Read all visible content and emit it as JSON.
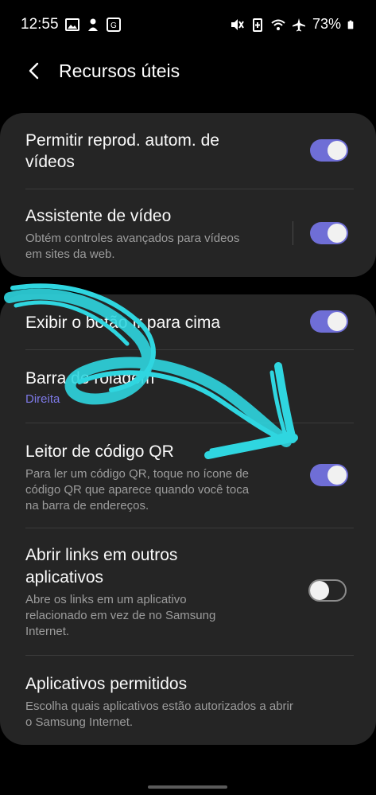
{
  "status_bar": {
    "time": "12:55",
    "battery": "73%",
    "left_icons": [
      "image-icon",
      "person-icon",
      "translate-icon"
    ],
    "right_icons": [
      "mute-icon",
      "battery-saver-icon",
      "wifi-icon",
      "airplane-icon",
      "battery-icon"
    ]
  },
  "header": {
    "title": "Recursos úteis"
  },
  "card1": {
    "items": [
      {
        "title_line1": "Permitir reprod. autom. de",
        "title_line2": "vídeos",
        "toggle": true
      },
      {
        "title": "Assistente de vídeo",
        "sub_line1": "Obtém controles avançados para vídeos",
        "sub_line2": "em sites da web.",
        "toggle": true
      }
    ]
  },
  "card2": {
    "items": [
      {
        "title": "Exibir o botão Ir para cima",
        "toggle": true
      },
      {
        "title": "Barra de rolagem",
        "sub": "Direita"
      },
      {
        "title": "Leitor de código QR",
        "sub_line1": "Para ler um código QR, toque no ícone de",
        "sub_line2": "código QR que aparece quando você toca",
        "sub_line3": "na barra de endereços.",
        "toggle": true
      },
      {
        "title_line1": "Abrir links em outros",
        "title_line2": "aplicativos",
        "sub_line1": "Abre os links em um aplicativo",
        "sub_line2": "relacionado em vez de no Samsung",
        "sub_line3": "Internet.",
        "toggle": false
      },
      {
        "title": "Aplicativos permitidos",
        "sub_line1": "Escolha quais aplicativos estão autorizados a abrir",
        "sub_line2": "o Samsung Internet."
      }
    ]
  },
  "colors": {
    "background": "#000000",
    "card": "#252525",
    "toggle_on": "#6f6ed6",
    "accent_text": "#7d79e6",
    "scribble": "#2fd6e0"
  }
}
